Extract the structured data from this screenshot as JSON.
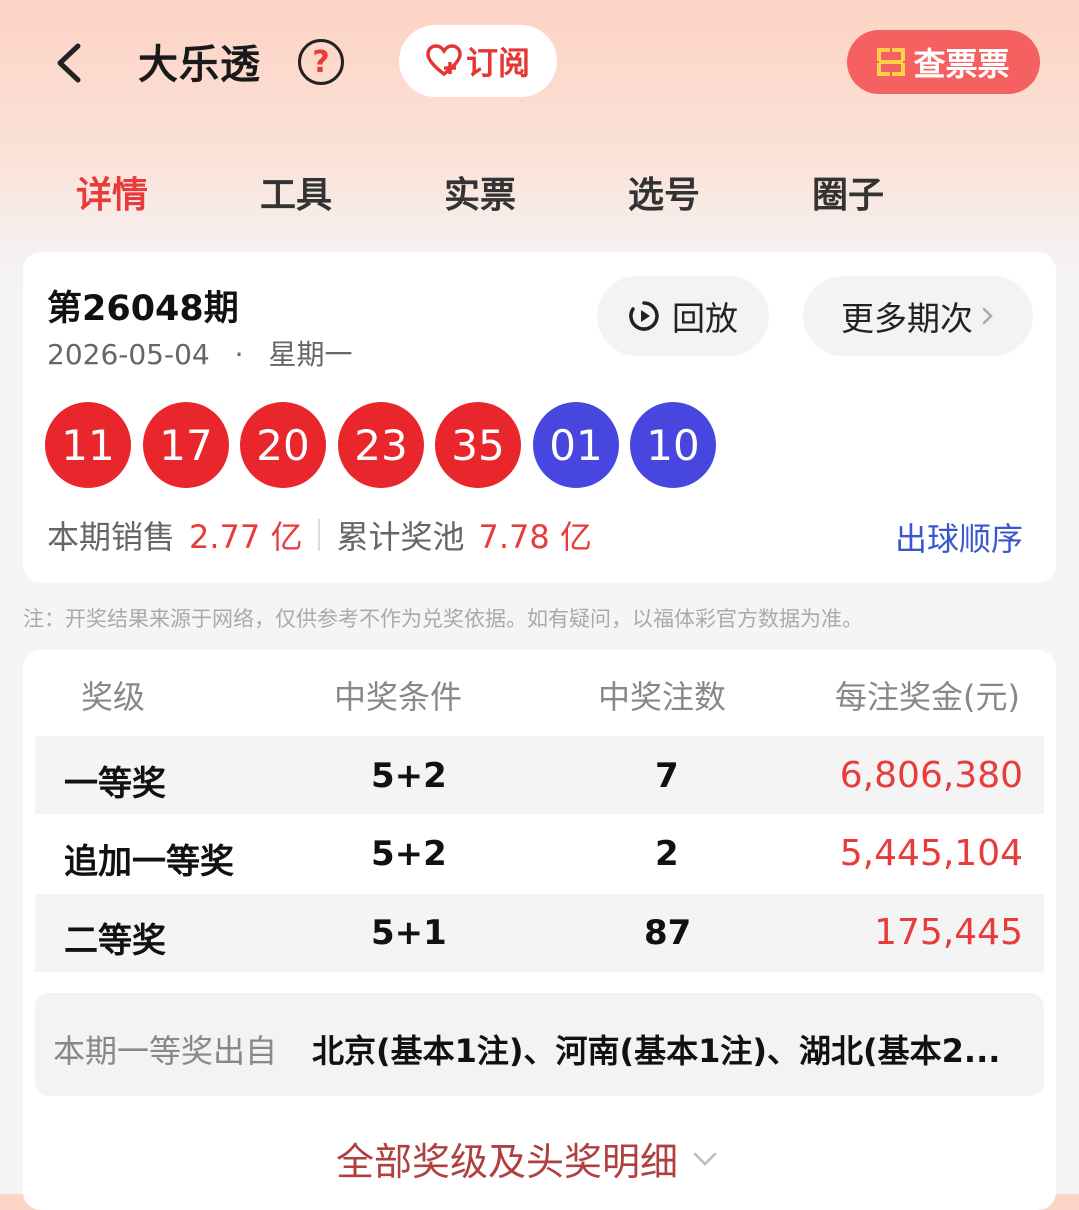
{
  "header": {
    "title": "大乐透",
    "help_glyph": "?",
    "subscribe_label": "订阅",
    "check_ticket_label": "查票票"
  },
  "tabs": [
    {
      "label": "详情",
      "active": true
    },
    {
      "label": "工具",
      "active": false
    },
    {
      "label": "实票",
      "active": false
    },
    {
      "label": "选号",
      "active": false
    },
    {
      "label": "圈子",
      "active": false
    }
  ],
  "draw": {
    "issue": "第26048期",
    "date": "2026-05-04",
    "dot": "·",
    "weekday": "星期一",
    "replay_label": "回放",
    "more_label": "更多期次",
    "red_balls": [
      "11",
      "17",
      "20",
      "23",
      "35"
    ],
    "blue_balls": [
      "01",
      "10"
    ],
    "sales_label": "本期销售",
    "sales_value": "2.77 亿",
    "pool_label": "累计奖池",
    "pool_value": "7.78 亿",
    "order_link": "出球顺序"
  },
  "note": "注：开奖结果来源于网络，仅供参考不作为兑奖依据。如有疑问，以福体彩官方数据为准。",
  "prize_table": {
    "headers": [
      "奖级",
      "中奖条件",
      "中奖注数",
      "每注奖金(元)"
    ],
    "rows": [
      {
        "level": "一等奖",
        "condition": "5+2",
        "count": "7",
        "amount": "6,806,380"
      },
      {
        "level": "追加一等奖",
        "condition": "5+2",
        "count": "2",
        "amount": "5,445,104"
      },
      {
        "level": "二等奖",
        "condition": "5+1",
        "count": "87",
        "amount": "175,445"
      }
    ]
  },
  "winners": {
    "label": "本期一等奖出自",
    "value": "北京(基本1注)、河南(基本1注)、湖北(基本2..."
  },
  "detail_link": "全部奖级及头奖明细",
  "colors": {
    "accent_red": "#e83b3b",
    "ball_red": "#e8262b",
    "ball_blue": "#4747e0",
    "link_blue": "#3a57d0"
  }
}
